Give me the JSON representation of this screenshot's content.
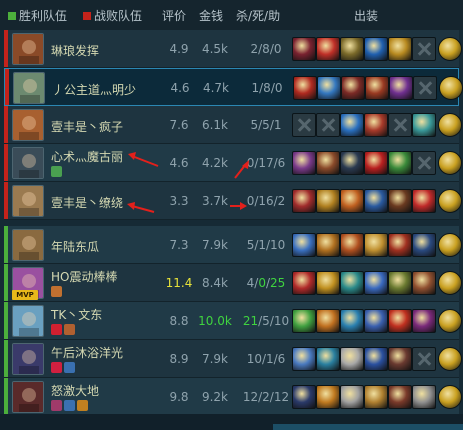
{
  "header": {
    "win_label": "胜利队伍",
    "lose_label": "战败队伍",
    "score_label": "评价",
    "gold_label": "金钱",
    "kda_label": "杀/死/助",
    "items_label": "出装",
    "win_color": "#4caf3c",
    "lose_color": "#c4231b"
  },
  "players": [
    {
      "name": "琳琅发挥",
      "score": "4.9",
      "gold": "4.5k",
      "kda": "2/8/0",
      "team": "lose",
      "avatar": "#8a4a28",
      "badges": [],
      "mvp": false,
      "items": [
        "#7a2230",
        "#c03028",
        "#7b6a2a",
        "#2060b0",
        "#b88a20",
        "empty",
        "#c9a020"
      ]
    },
    {
      "name": "丿公主道灬明少",
      "score": "4.6",
      "gold": "4.7k",
      "kda": "1/8/0",
      "team": "lose",
      "self": true,
      "avatar": "#6c8a70",
      "badges": [],
      "mvp": false,
      "items": [
        "#b02a20",
        "#3478c0",
        "#7c2a26",
        "#9a3a22",
        "#703090",
        "empty",
        "#c9a020"
      ]
    },
    {
      "name": "壹丰是丶疯子",
      "score": "7.6",
      "gold": "6.1k",
      "kda": "5/5/1",
      "team": "lose",
      "avatar": "#a86030",
      "badges": [],
      "mvp": false,
      "items": [
        "empty",
        "empty",
        "#2a70c0",
        "#a83a2a",
        "empty",
        "#3a9a9a",
        "#c9a020"
      ]
    },
    {
      "name": "心术灬魔古丽",
      "score": "4.6",
      "gold": "4.2k",
      "kda": "0/17/6",
      "team": "lose",
      "avatar": "#3a4c58",
      "badges": [
        "#4aa050"
      ],
      "mvp": false,
      "items": [
        "#7a3a8a",
        "#8a4a2a",
        "#2a3a50",
        "#b82020",
        "#3a8a3a",
        "empty",
        "#c9a020"
      ]
    },
    {
      "name": "壹丰是丶缭绕",
      "score": "3.3",
      "gold": "3.7k",
      "kda": "0/16/2",
      "team": "lose",
      "avatar": "#9a7a50",
      "badges": [],
      "mvp": false,
      "items": [
        "#a02c2c",
        "#b08020",
        "#c06020",
        "#2a5aa0",
        "#6a3a20",
        "#c02a2a",
        "#c9a020"
      ]
    },
    {
      "name": "年陆东瓜",
      "score": "7.3",
      "gold": "7.9k",
      "kda": "5/1/10",
      "team": "win",
      "avatar": "#8a6a40",
      "badges": [],
      "mvp": false,
      "items": [
        "#3a70c0",
        "#b07020",
        "#b05020",
        "#c09030",
        "#a03020",
        "#2a4a80",
        "#c9a020"
      ]
    },
    {
      "name": "HO震动棒棒",
      "score": "11.4",
      "gold": "8.4k",
      "kda": "4/0/25",
      "team": "win",
      "avatar": "#9a50a0",
      "badges": [
        "#c07030"
      ],
      "mvp": true,
      "score_hi": "y",
      "kda_hi": "0/25",
      "items": [
        "#b02a2a",
        "#c09020",
        "#2a8a8a",
        "#3a6ac0",
        "#6a7a30",
        "#905030",
        "#c9a020"
      ]
    },
    {
      "name": "TK丶文东",
      "score": "8.8",
      "gold": "10.0k",
      "kda": "21/5/10",
      "team": "win",
      "avatar": "#6aa0c0",
      "badges": [
        "#d02030",
        "#b06030"
      ],
      "mvp": false,
      "gold_hi": "g",
      "kda_hi": "21",
      "items": [
        "#40a040",
        "#c07020",
        "#2a80b0",
        "#3a60b0",
        "#c03020",
        "#7a2a7a",
        "#c9a020"
      ]
    },
    {
      "name": "午后沐浴洋光",
      "score": "8.9",
      "gold": "7.9k",
      "kda": "10/1/6",
      "team": "win",
      "avatar": "#3a3a6a",
      "badges": [
        "#d02040",
        "#3a70b0"
      ],
      "mvp": false,
      "items": [
        "#4a7ac0",
        "#2a80a0",
        "#a8a8a8",
        "#2a50a0",
        "#6a3a30",
        "empty",
        "#c9a020"
      ]
    },
    {
      "name": "怒激大地",
      "score": "9.8",
      "gold": "9.2k",
      "kda": "12/2/12",
      "team": "win",
      "avatar": "#5a2a2a",
      "badges": [
        "#a03a6a",
        "#3a70b0",
        "#c08020"
      ],
      "mvp": false,
      "items": [
        "#2a3a6a",
        "#c07a20",
        "#a0a0a0",
        "#b08030",
        "#7a3a2a",
        "#909090",
        "#c9a020"
      ]
    }
  ]
}
